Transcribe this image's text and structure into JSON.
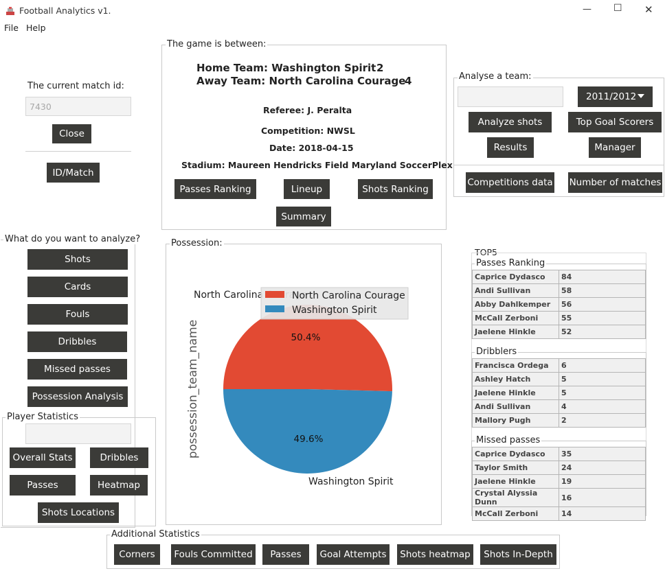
{
  "window": {
    "title": "Football Analytics v1.",
    "minimize_glyph": "—",
    "maximize_glyph": "☐",
    "close_glyph": "✕"
  },
  "menu": {
    "file": "File",
    "help": "Help"
  },
  "left": {
    "current_match_label": "The current match id:",
    "match_id_value": "7430",
    "close_button": "Close",
    "id_match_button": "ID/Match"
  },
  "game": {
    "group_title": "The game is between:",
    "home_line": "Home Team: Washington Spirit",
    "home_score": "2",
    "away_line": "Away Team: North Carolina Courage",
    "away_score": "4",
    "referee": "Referee: J. Peralta",
    "competition": "Competition: NWSL",
    "date": "Date: 2018-04-15",
    "stadium": "Stadium: Maureen Hendricks Field Maryland SoccerPlex",
    "buttons": {
      "passes_ranking": "Passes Ranking",
      "lineup": "Lineup",
      "shots_ranking": "Shots Ranking",
      "summary": "Summary"
    }
  },
  "analyse_team": {
    "group_title": "Analyse a team:",
    "team_input_value": "",
    "season_selected": "2011/2012",
    "buttons": {
      "analyze_shots": "Analyze shots",
      "top_goal_scorers": "Top Goal Scorers",
      "results": "Results",
      "manager": "Manager",
      "competitions_data": "Competitions data",
      "number_of_matches": "Number of matches"
    }
  },
  "analyze": {
    "group_title": "What do you want to analyze?",
    "buttons": {
      "shots": "Shots",
      "cards": "Cards",
      "fouls": "Fouls",
      "dribbles": "Dribbles",
      "missed_passes": "Missed passes",
      "possession_analysis": "Possession Analysis"
    }
  },
  "player_stats": {
    "group_title": "Player Statistics",
    "player_input_value": "",
    "buttons": {
      "overall_stats": "Overall Stats",
      "dribbles": "Dribbles",
      "passes": "Passes",
      "heatmap": "Heatmap",
      "shots_locations": "Shots Locations"
    }
  },
  "possession": {
    "group_title": "Possession:",
    "colors": {
      "nc_courage": "#e24a33",
      "washington": "#348abd"
    }
  },
  "chart_data": {
    "type": "pie",
    "ylabel": "possession_team_name",
    "categories": [
      "North Carolina Courage",
      "Washington Spirit"
    ],
    "slice_labels": [
      "North Carolina Courage",
      "Washington Spirit"
    ],
    "values": [
      50.4,
      49.6
    ],
    "value_labels": [
      "50.4%",
      "49.6%"
    ],
    "legend": [
      "North Carolina Courage",
      "Washington Spirit"
    ],
    "legend_position": "top-right",
    "colors": [
      "#e24a33",
      "#348abd"
    ]
  },
  "top5": {
    "group_title": "TOP5",
    "passes": {
      "title": "Passes Ranking",
      "rows": [
        {
          "name": "Caprice Dydasco",
          "value": "84"
        },
        {
          "name": "Andi Sullivan",
          "value": "58"
        },
        {
          "name": "Abby Dahlkemper",
          "value": "56"
        },
        {
          "name": "McCall Zerboni",
          "value": "55"
        },
        {
          "name": "Jaelene Hinkle",
          "value": "52"
        }
      ]
    },
    "dribblers": {
      "title": "Dribblers",
      "rows": [
        {
          "name": "Francisca Ordega",
          "value": "6"
        },
        {
          "name": "Ashley Hatch",
          "value": "5"
        },
        {
          "name": "Jaelene Hinkle",
          "value": "5"
        },
        {
          "name": "Andi Sullivan",
          "value": "4"
        },
        {
          "name": "Mallory Pugh",
          "value": "2"
        }
      ]
    },
    "missed": {
      "title": "Missed passes",
      "rows": [
        {
          "name": "Caprice Dydasco",
          "value": "35"
        },
        {
          "name": "Taylor Smith",
          "value": "24"
        },
        {
          "name": "Jaelene Hinkle",
          "value": "19"
        },
        {
          "name": "Crystal Alyssia Dunn",
          "value": "16"
        },
        {
          "name": "McCall Zerboni",
          "value": "14"
        }
      ]
    }
  },
  "additional": {
    "group_title": "Additional Statistics",
    "buttons": {
      "corners": "Corners",
      "fouls_committed": "Fouls Committed",
      "passes": "Passes",
      "goal_attempts": "Goal Attempts",
      "shots_heatmap": "Shots heatmap",
      "shots_in_depth": "Shots In-Depth"
    }
  }
}
